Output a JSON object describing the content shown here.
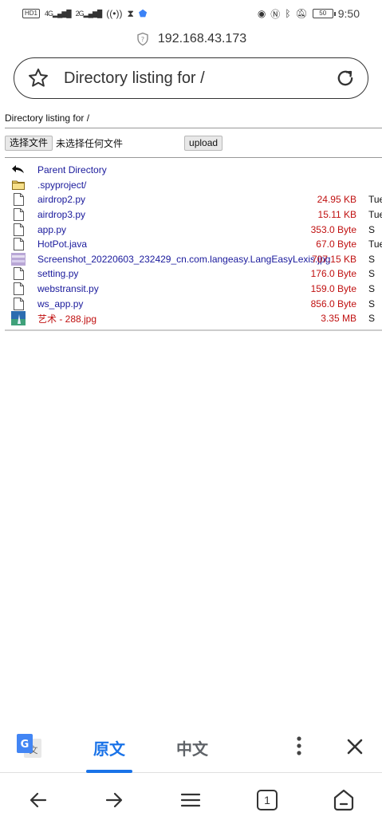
{
  "status_bar": {
    "hd_badge": "HD1",
    "signal_1": "4G",
    "signal_2": "2G",
    "battery": "50",
    "time": "9:50"
  },
  "address": {
    "url": "192.168.43.173"
  },
  "title_bar": {
    "title": "Directory listing for /"
  },
  "page": {
    "heading": "Directory listing for /",
    "choose_file_label": "选择文件",
    "no_file_text": "未选择任何文件",
    "upload_label": "upload",
    "files": [
      {
        "name": "Parent Directory",
        "size": "",
        "date": "",
        "icon": "back-arrow-icon",
        "style": "blue"
      },
      {
        "name": ".spyproject/",
        "size": "",
        "date": "",
        "icon": "folder-icon",
        "style": "blue"
      },
      {
        "name": "airdrop2.py",
        "size": "24.95 KB",
        "date": "Tue",
        "icon": "file-icon",
        "style": "blue"
      },
      {
        "name": "airdrop3.py",
        "size": "15.11 KB",
        "date": "Tue",
        "icon": "file-icon",
        "style": "blue"
      },
      {
        "name": "app.py",
        "size": "353.0 Byte",
        "date": "S",
        "icon": "file-icon",
        "style": "blue"
      },
      {
        "name": "HotPot.java",
        "size": "67.0 Byte",
        "date": "Tue",
        "icon": "file-icon",
        "style": "blue"
      },
      {
        "name": "Screenshot_20220603_232429_cn.com.langeasy.LangEasyLexis.jpg",
        "size": "707.15 KB",
        "date": "S",
        "icon": "image-thumbnail-icon",
        "style": "blue"
      },
      {
        "name": "setting.py",
        "size": "176.0 Byte",
        "date": "S",
        "icon": "file-icon",
        "style": "blue"
      },
      {
        "name": "webstransit.py",
        "size": "159.0 Byte",
        "date": "S",
        "icon": "file-icon",
        "style": "blue"
      },
      {
        "name": "ws_app.py",
        "size": "856.0 Byte",
        "date": "S",
        "icon": "file-icon",
        "style": "blue"
      },
      {
        "name": "艺术 - 288.jpg",
        "size": "3.35 MB",
        "date": "S",
        "icon": "image-thumbnail-icon",
        "style": "red"
      }
    ]
  },
  "translate_bar": {
    "original_label": "原文",
    "chinese_label": "中文",
    "colors": {
      "accent": "#1a73e8"
    }
  },
  "bottom_nav": {
    "tab_count": "1"
  }
}
